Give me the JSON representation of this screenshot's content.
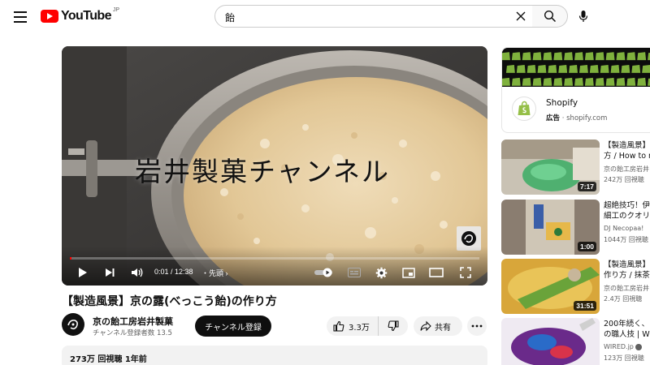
{
  "header": {
    "logo_text": "YouTube",
    "logo_country": "JP",
    "search_value": "飴",
    "search_placeholder": "検索"
  },
  "player": {
    "overlay_title": "岩井製菓チャンネル",
    "current_time": "0:01",
    "duration": "12:38",
    "time_display": "0:01 / 12:38",
    "chapter": "・先頭",
    "progress_fraction": 0.0013
  },
  "video": {
    "title": "【製造風景】京の露(べっこう飴)の作り方",
    "channel_name": "京の飴工房岩井製菓",
    "subscribers": "チャンネル登録者数 13.5",
    "subscribe_label": "チャンネル登録",
    "likes": "3.3万",
    "share_label": "共有",
    "views_date": "273万 回視聴 1年前"
  },
  "ad": {
    "advertiser": "Shopify",
    "label": "広告",
    "domain": "shopify.com",
    "brand_color": "#95bf47"
  },
  "recommendations": [
    {
      "title_lines": [
        "【製造風景】",
        "方 / How to m"
      ],
      "channel": "京の飴工房岩井",
      "stats": "242万 回視聴",
      "duration": "7:17"
    },
    {
      "title_lines": [
        "超絶技巧！伊",
        "細工のクオリ"
      ],
      "channel": "DJ Necopaa!",
      "stats": "1044万 回視聴",
      "duration": "1:00"
    },
    {
      "title_lines": [
        "【製造風景】",
        "作り方 / 抹茶"
      ],
      "channel": "京の飴工房岩井",
      "stats": "2.4万 回視聴",
      "duration": "31:51"
    },
    {
      "title_lines": [
        "200年続く、",
        "の職人技 | W"
      ],
      "channel": "WIRED.jp",
      "stats": "123万 回視聴",
      "duration": ""
    }
  ]
}
